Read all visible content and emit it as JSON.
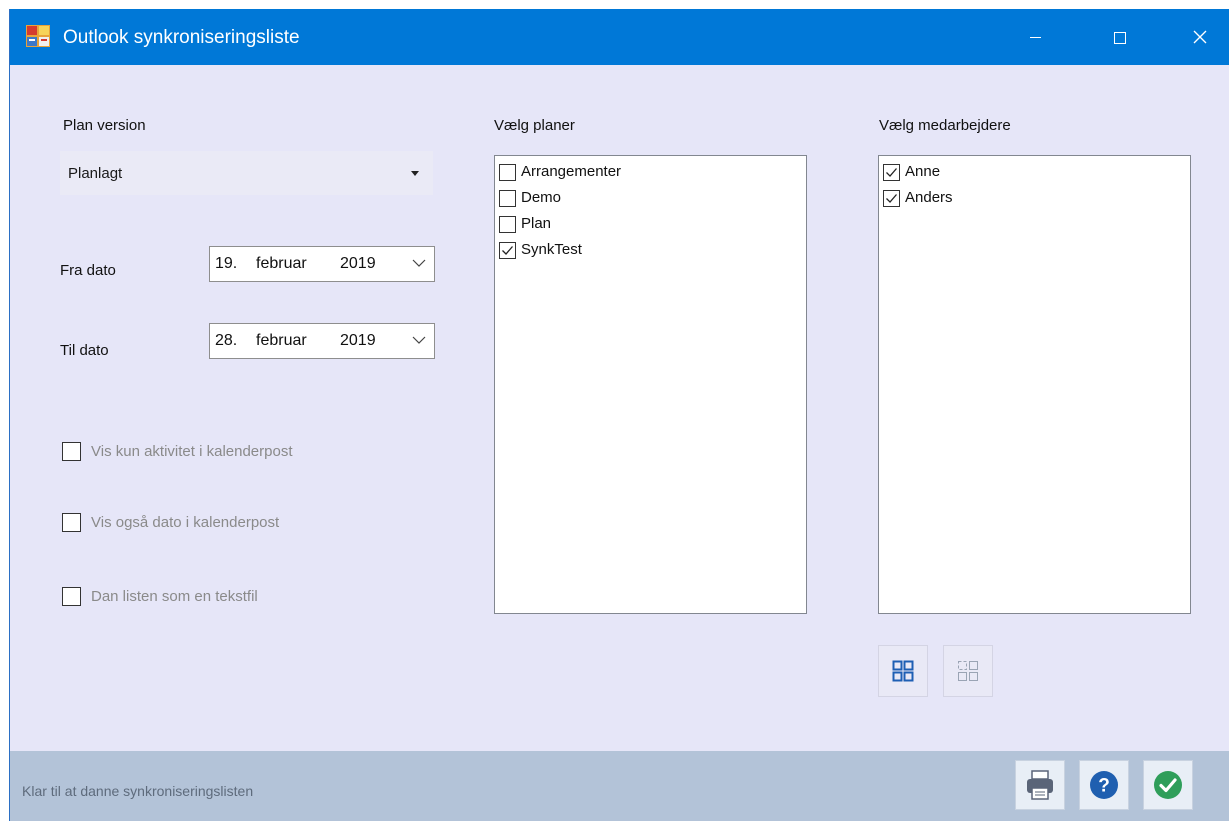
{
  "window": {
    "title": "Outlook synkroniseringsliste"
  },
  "plan_version": {
    "label": "Plan version",
    "selected": "Planlagt"
  },
  "from_date": {
    "label": "Fra dato",
    "day": "19.",
    "month": "februar",
    "year": "2019"
  },
  "to_date": {
    "label": "Til dato",
    "day": "28.",
    "month": "februar",
    "year": "2019"
  },
  "options": [
    {
      "label": "Vis kun aktivitet i kalenderpost",
      "checked": false
    },
    {
      "label": "Vis også dato i kalenderpost",
      "checked": false
    },
    {
      "label": "Dan listen som en tekstfil",
      "checked": false
    }
  ],
  "plans": {
    "label": "Vælg planer",
    "items": [
      {
        "label": "Arrangementer",
        "checked": false
      },
      {
        "label": "Demo",
        "checked": false
      },
      {
        "label": "Plan",
        "checked": false
      },
      {
        "label": "SynkTest",
        "checked": true
      }
    ]
  },
  "employees": {
    "label": "Vælg medarbejdere",
    "items": [
      {
        "label": "Anne",
        "checked": true
      },
      {
        "label": "Anders",
        "checked": true
      }
    ],
    "select_all_icon": "select-all-icon",
    "deselect_all_icon": "deselect-all-icon"
  },
  "status": {
    "text": "Klar til at danne synkroniseringslisten"
  },
  "footer_buttons": {
    "print_icon": "printer-icon",
    "help_icon": "help-icon",
    "ok_icon": "checkmark-icon"
  },
  "colors": {
    "titlebar": "#0078d7",
    "window_bg": "#e6e6f8",
    "statusbar": "#b3c3d8",
    "help_blue": "#1f5fb0",
    "ok_green": "#2f9e5a"
  }
}
